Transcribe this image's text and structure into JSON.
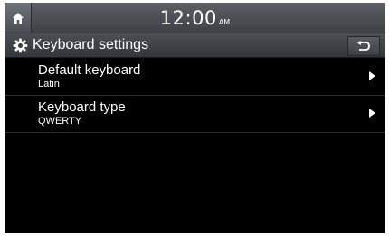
{
  "status_bar": {
    "time": "12:00",
    "ampm": "AM",
    "home_icon": "home-icon"
  },
  "header": {
    "title": "Keyboard settings",
    "icon": "gear-icon",
    "back_icon": "back-return-icon"
  },
  "settings": [
    {
      "label": "Default keyboard",
      "value": "Latin",
      "icon": "chevron-right-icon"
    },
    {
      "label": "Keyboard type",
      "value": "QWERTY",
      "icon": "chevron-right-icon"
    }
  ],
  "colors": {
    "background": "#000000",
    "bar": "#4b4e53",
    "text": "#ffffff"
  }
}
